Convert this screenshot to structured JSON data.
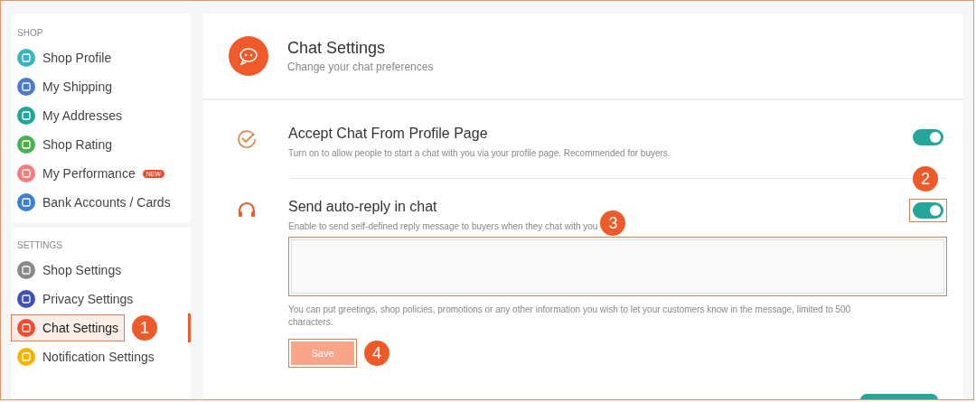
{
  "sidebar": {
    "sections": [
      {
        "title": "SHOP",
        "items": [
          {
            "label": "Shop Profile",
            "color": "#3bb3c3",
            "selected": false
          },
          {
            "label": "My Shipping",
            "color": "#4a7cc9",
            "selected": false
          },
          {
            "label": "My Addresses",
            "color": "#1fa59a",
            "selected": false
          },
          {
            "label": "Shop Rating",
            "color": "#4caf50",
            "selected": false
          },
          {
            "label": "My Performance",
            "color": "#f47c7c",
            "selected": false,
            "badge": "NEW"
          },
          {
            "label": "Bank Accounts / Cards",
            "color": "#3f7fd0",
            "selected": false
          }
        ]
      },
      {
        "title": "SETTINGS",
        "items": [
          {
            "label": "Shop Settings",
            "color": "#8a8a8a",
            "selected": false
          },
          {
            "label": "Privacy Settings",
            "color": "#3f51b5",
            "selected": false
          },
          {
            "label": "Chat Settings",
            "color": "#ee4d2d",
            "selected": true,
            "callout": "1"
          },
          {
            "label": "Notification Settings",
            "color": "#f4b400",
            "selected": false
          }
        ]
      }
    ]
  },
  "header": {
    "title": "Chat Settings",
    "subtitle": "Change your chat preferences"
  },
  "settings": [
    {
      "kind": "check",
      "title": "Accept Chat From Profile Page",
      "description": "Turn on to allow people to start a chat with you via your profile page. Recommended for buyers.",
      "on": true
    },
    {
      "kind": "headset",
      "title": "Send auto-reply in chat",
      "description": "Enable to send self-defined reply message to buyers when they chat with you",
      "on": true,
      "toggle_callout": "2",
      "description_callout": "3",
      "reply": {
        "hint": "You can put greetings, shop policies, promotions or any other information you wish to let your customers know in the message, limited to 500 characters.",
        "button": "Save",
        "button_callout": "4"
      }
    }
  ]
}
